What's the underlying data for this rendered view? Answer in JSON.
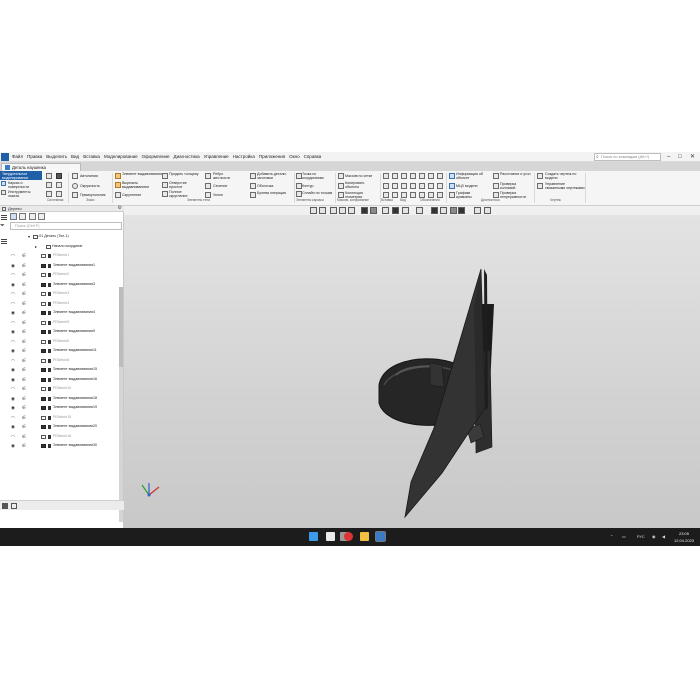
{
  "menubar": {
    "items": [
      "Файл",
      "Правка",
      "Выделить",
      "Вид",
      "Вставка",
      "Моделирование",
      "Оформление",
      "Диагностика",
      "Управление",
      "Настройка",
      "Приложения",
      "Окно",
      "Справка"
    ],
    "search_placeholder": "Поиск по командам (Alt+/)"
  },
  "document_tab": {
    "label": "Деталь наушника"
  },
  "ribbon": {
    "left_panel": {
      "selected": "Твердотельное моделирование",
      "items": [
        "Каркас и поверхности",
        "Инструменты эскиза"
      ]
    },
    "items": {
      "auto_line": "Автолиния",
      "circle": "Окружность",
      "rectangle": "Прямоугольник",
      "extrude": "Элемент выдавливания",
      "cut_extrude": "Вырезать выдавливанием",
      "fillet": "Скругление",
      "drill": "Придать толщину",
      "hole": "Отверстие простое",
      "full_fillet": "Полное скругление",
      "rib": "Ребро жесткости",
      "section": "Сечение",
      "slope": "Уклон",
      "add_parts": "Добавить детали-заготовки",
      "shell": "Оболочка",
      "boolean": "Булева операция",
      "point": "Точка по координатам",
      "contour": "Контур",
      "spline": "Сплайн по точкам",
      "mesh_array": "Массив по сетке",
      "copy_objects": "Копировать объекты",
      "geom_collection": "Коллекция геометрии",
      "object_info": "Информация об объекте",
      "mcx": "МЦХ модели",
      "graph_curves": "Графики кривизны",
      "distance_angle": "Расстояние и угол",
      "check_collisions": "Проверка коллизий",
      "check_continuity": "Проверка непрерывности",
      "create_drawing": "Создать чертеж по модели",
      "manage_drawing": "Управление связанными чертежами"
    },
    "groups": [
      "Системная",
      "Эскиз",
      "Элементы тела",
      "Элементы каркаса",
      "Массив, копирование",
      "Вставка",
      "Вид",
      "Обозначения",
      "Диагностика",
      "Чертеж"
    ]
  },
  "tree_panel": {
    "title": "Дерево",
    "search_placeholder": "Поиск (Ctrl+F)",
    "root": "-01 Деталь (Тел-1)",
    "origin": "Начало координат",
    "rows": [
      {
        "label": "PlSketch1",
        "type": "sketch"
      },
      {
        "label": "Элемент выдавливания1",
        "type": "feature"
      },
      {
        "label": "PlSketch2",
        "type": "sketch"
      },
      {
        "label": "Элемент выдавливания3",
        "type": "feature"
      },
      {
        "label": "PlSketch3",
        "type": "sketch"
      },
      {
        "label": "PlSketch4",
        "type": "sketch"
      },
      {
        "label": "Элемент выдавливания4",
        "type": "feature"
      },
      {
        "label": "PlSketch5",
        "type": "sketch"
      },
      {
        "label": "Элемент выдавливания9",
        "type": "feature"
      },
      {
        "label": "PlSketch6",
        "type": "sketch"
      },
      {
        "label": "Элемент выдавливания11",
        "type": "feature"
      },
      {
        "label": "PlSketch8",
        "type": "sketch"
      },
      {
        "label": "Элемент выдавливания15",
        "type": "feature"
      },
      {
        "label": "Элемент выдавливания16",
        "type": "feature"
      },
      {
        "label": "PlSketch10",
        "type": "sketch"
      },
      {
        "label": "Элемент выдавливания18",
        "type": "feature"
      },
      {
        "label": "Элемент выдавливания19",
        "type": "feature"
      },
      {
        "label": "PlSketch15",
        "type": "sketch"
      },
      {
        "label": "Элемент выдавливания20",
        "type": "feature"
      },
      {
        "label": "PlSketch18",
        "type": "sketch"
      },
      {
        "label": "Элемент выдавливания30",
        "type": "feature"
      }
    ]
  },
  "taskbar": {
    "lang": "РУС",
    "time": "23:05",
    "date": "12.04.2023"
  },
  "colors": {
    "accent": "#1f5fa8",
    "model": "#2e2e2e",
    "viewport_top": "#e3e3e3",
    "viewport_bottom": "#c8c8c8",
    "taskbar": "#1c1c1c"
  }
}
